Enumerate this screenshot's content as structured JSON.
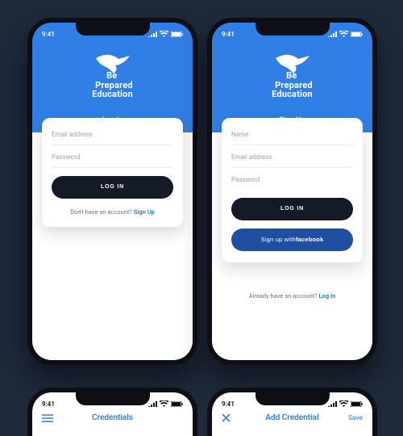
{
  "meta": {
    "accent": "#2f7fe6",
    "dark": "#141a26",
    "bg": "#1e293a",
    "fb": "#1f4fa0"
  },
  "status": {
    "time": "9:41",
    "signal_icon": "signal-icon",
    "wifi_icon": "wifi-icon",
    "battery_icon": "battery-icon"
  },
  "brand": {
    "line1": "Be",
    "line2": "Prepared",
    "line3": "Education"
  },
  "login": {
    "title": "Log in",
    "fields": {
      "email": "Email address",
      "password": "Password"
    },
    "primary": "LOG IN",
    "prompt": "Don't have an account?",
    "prompt_link": "Sign Up"
  },
  "signup": {
    "title": "Sign Up",
    "fields": {
      "name": "Name",
      "email": "Email address",
      "password": "Password"
    },
    "primary": "LOG IN",
    "fb_prefix": "Sign up with ",
    "fb_brand": "facebook",
    "prompt": "Already have an account?",
    "prompt_link": "Log In"
  },
  "peekA": {
    "title": "Credentials"
  },
  "peekB": {
    "title": "Add Credential",
    "close": "×",
    "save": "Save"
  }
}
